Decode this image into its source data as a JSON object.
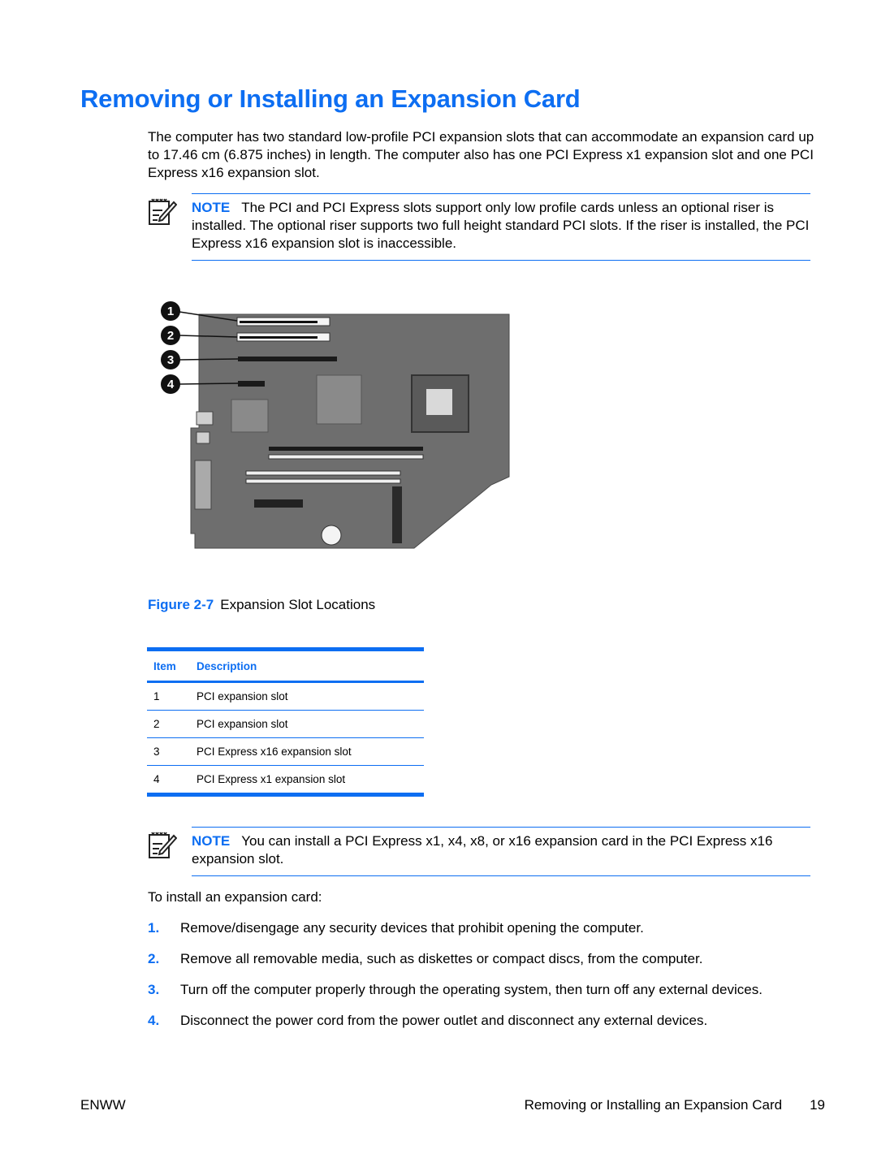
{
  "page": {
    "title": "Removing or Installing an Expansion Card",
    "intro": "The computer has two standard low-profile PCI expansion slots that can accommodate an expansion card up to 17.46 cm (6.875 inches) in length. The computer also has one PCI Express x1 expansion slot and one PCI Express x16 expansion slot.",
    "notes": [
      {
        "icon": "note-pencil-icon",
        "label": "NOTE",
        "text": "The PCI and PCI Express slots support only low profile cards unless an optional riser is installed. The optional riser supports two full height standard PCI slots. If the riser is installed, the PCI Express x16 expansion slot is inaccessible."
      },
      {
        "icon": "note-pencil-icon",
        "label": "NOTE",
        "text": "You can install a PCI Express x1, x4, x8, or x16 expansion card in the PCI Express x16 expansion slot."
      }
    ],
    "figure": {
      "label": "Figure 2-7",
      "caption": "Expansion Slot Locations",
      "callouts": [
        "1",
        "2",
        "3",
        "4"
      ],
      "alt": "System board showing expansion slot locations"
    },
    "table": {
      "headers": [
        "Item",
        "Description"
      ],
      "rows": [
        [
          "1",
          "PCI expansion slot"
        ],
        [
          "2",
          "PCI expansion slot"
        ],
        [
          "3",
          "PCI Express x16 expansion slot"
        ],
        [
          "4",
          "PCI Express x1 expansion slot"
        ]
      ]
    },
    "lead": "To install an expansion card:",
    "steps": [
      {
        "num": "1.",
        "text": "Remove/disengage any security devices that prohibit opening the computer."
      },
      {
        "num": "2.",
        "text": "Remove all removable media, such as diskettes or compact discs, from the computer."
      },
      {
        "num": "3.",
        "text": "Turn off the computer properly through the operating system, then turn off any external devices."
      },
      {
        "num": "4.",
        "text": "Disconnect the power cord from the power outlet and disconnect any external devices."
      }
    ],
    "footer": {
      "left": "ENWW",
      "section": "Removing or Installing an Expansion Card",
      "page_number": "19"
    },
    "colors": {
      "accent": "#0d6ef2",
      "board": "#6e6e6e"
    }
  }
}
